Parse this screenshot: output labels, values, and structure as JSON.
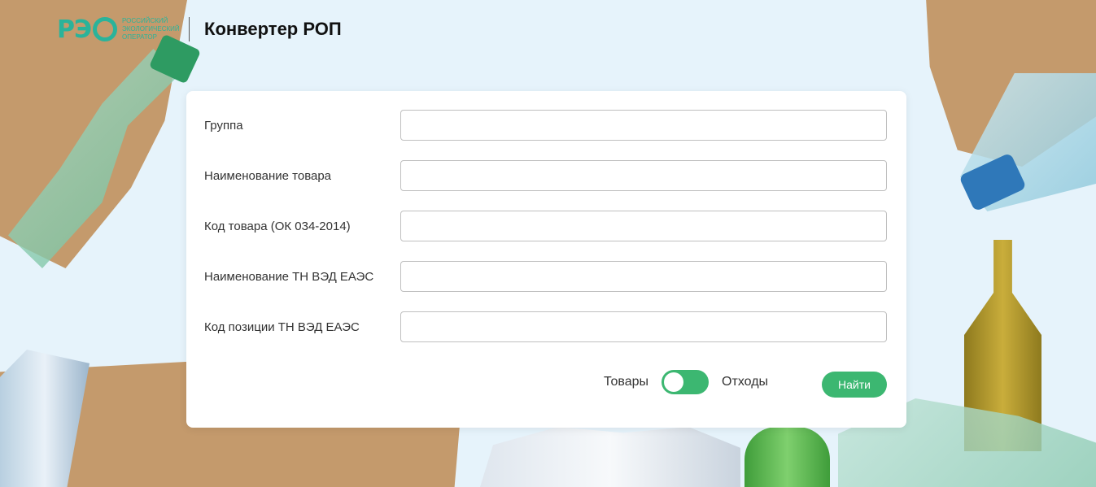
{
  "header": {
    "logo_mark": "РЭ",
    "logo_lines": [
      "РОССИЙСКИЙ",
      "ЭКОЛОГИЧЕСКИЙ",
      "ОПЕРАТОР"
    ],
    "title": "Конвертер РОП"
  },
  "form": {
    "fields": [
      {
        "label": "Группа",
        "value": "",
        "placeholder": ""
      },
      {
        "label": "Наименование товара",
        "value": "",
        "placeholder": ""
      },
      {
        "label": "Код товара (ОК 034-2014)",
        "value": "",
        "placeholder": ""
      },
      {
        "label": "Наименование ТН ВЭД ЕАЭС",
        "value": "",
        "placeholder": ""
      },
      {
        "label": "Код позиции ТН ВЭД ЕАЭС",
        "value": "",
        "placeholder": ""
      }
    ],
    "toggle": {
      "left_label": "Товары",
      "right_label": "Отходы",
      "selected": "Товары"
    },
    "submit_label": "Найти"
  },
  "colors": {
    "accent": "#3cb771",
    "logo": "#2bb39a",
    "background": "#e6f3fb"
  }
}
